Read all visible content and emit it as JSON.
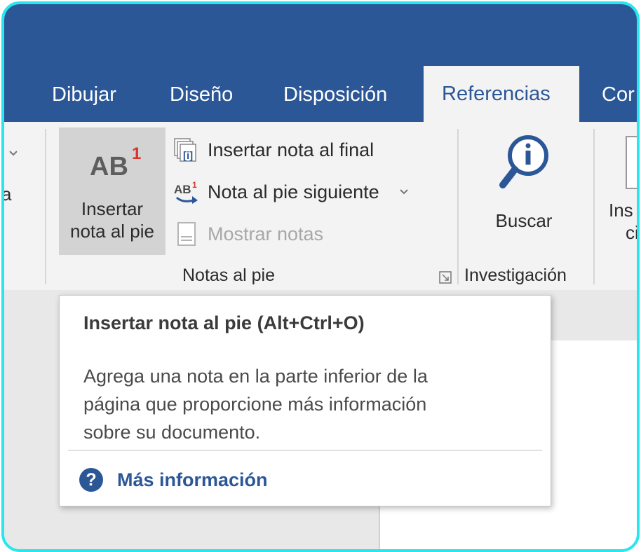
{
  "tabs": [
    {
      "label": "Dibujar"
    },
    {
      "label": "Diseño"
    },
    {
      "label": "Disposición"
    },
    {
      "label": "Referencias",
      "active": true
    },
    {
      "label": "Cor"
    }
  ],
  "ribbon": {
    "footnotes_group": {
      "insert_footnote_line1": "Insertar",
      "insert_footnote_line2": "nota al pie",
      "insert_endnote": "Insertar nota al final",
      "next_footnote": "Nota al pie siguiente",
      "show_notes": "Mostrar notas",
      "group_label": "Notas al pie"
    },
    "research_group": {
      "search_label": "Buscar",
      "group_label": "Investigación"
    },
    "partial_right": {
      "line1": "Ins",
      "line2": "ci"
    },
    "partial_left_glyph": "a"
  },
  "icons": {
    "ab_text": "AB",
    "ab_superscript": "1"
  },
  "tooltip": {
    "title": "Insertar nota al pie (Alt+Ctrl+O)",
    "description_lines": [
      "Agrega una nota en la parte inferior de la",
      "página que proporcione más información",
      "sobre su documento."
    ],
    "more_info": "Más información",
    "help_glyph": "?"
  },
  "colors": {
    "accent": "#2c5797",
    "frame_border": "#27e6ee",
    "footnote_red": "#d8342b"
  }
}
